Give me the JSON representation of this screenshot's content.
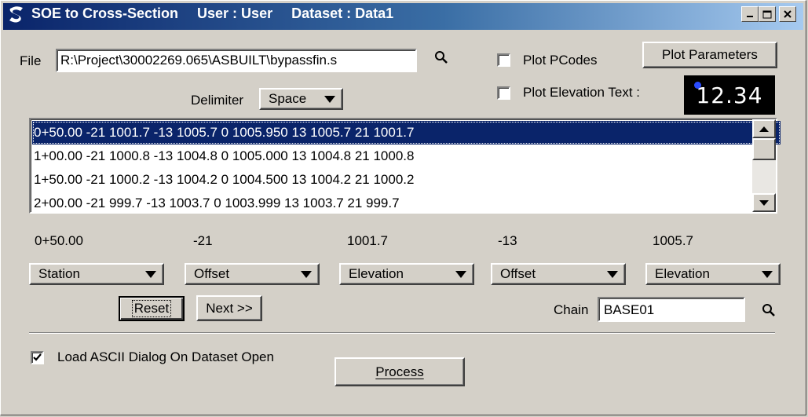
{
  "window": {
    "title": "SOE to Cross-Section",
    "user": "User : User",
    "dataset": "Dataset : Data1"
  },
  "file": {
    "label": "File",
    "value": "R:\\Project\\30002269.065\\ASBUILT\\bypassfin.s"
  },
  "delimiter": {
    "label": "Delimiter",
    "value": "Space"
  },
  "plot_pcodes": {
    "label": "Plot PCodes",
    "checked": false
  },
  "plot_parameters_label": "Plot Parameters",
  "plot_elevation_text": {
    "label": "Plot Elevation Text :",
    "checked": false,
    "sample": "12.34"
  },
  "list": {
    "rows": [
      "0+50.00 -21 1001.7 -13 1005.7 0 1005.950 13 1005.7 21 1001.7",
      "1+00.00 -21 1000.8 -13 1004.8 0 1005.000 13 1004.8 21 1000.8",
      "1+50.00 -21 1000.2 -13 1004.2 0 1004.500 13 1004.2 21 1000.2",
      "2+00.00 -21 999.7 -13 1003.7 0 1003.999 13 1003.7 21 999.7"
    ],
    "selected_index": 0
  },
  "columns": [
    {
      "value": "0+50.00",
      "type": "Station"
    },
    {
      "value": "-21",
      "type": "Offset"
    },
    {
      "value": "1001.7",
      "type": "Elevation"
    },
    {
      "value": "-13",
      "type": "Offset"
    },
    {
      "value": "1005.7",
      "type": "Elevation"
    }
  ],
  "reset_label": "Reset",
  "next_label": "Next >>",
  "chain": {
    "label": "Chain",
    "value": "BASE01"
  },
  "load_ascii": {
    "label": "Load ASCII Dialog On Dataset Open",
    "checked": true
  },
  "process_label": "Process",
  "icons": {
    "search": "magnifier-icon",
    "app": "app-logo-icon",
    "check": "check-mark"
  },
  "colors": {
    "titlebar_start": "#0a246a",
    "selection": "#0a246a",
    "dialog_bg": "#d4d0c8"
  }
}
